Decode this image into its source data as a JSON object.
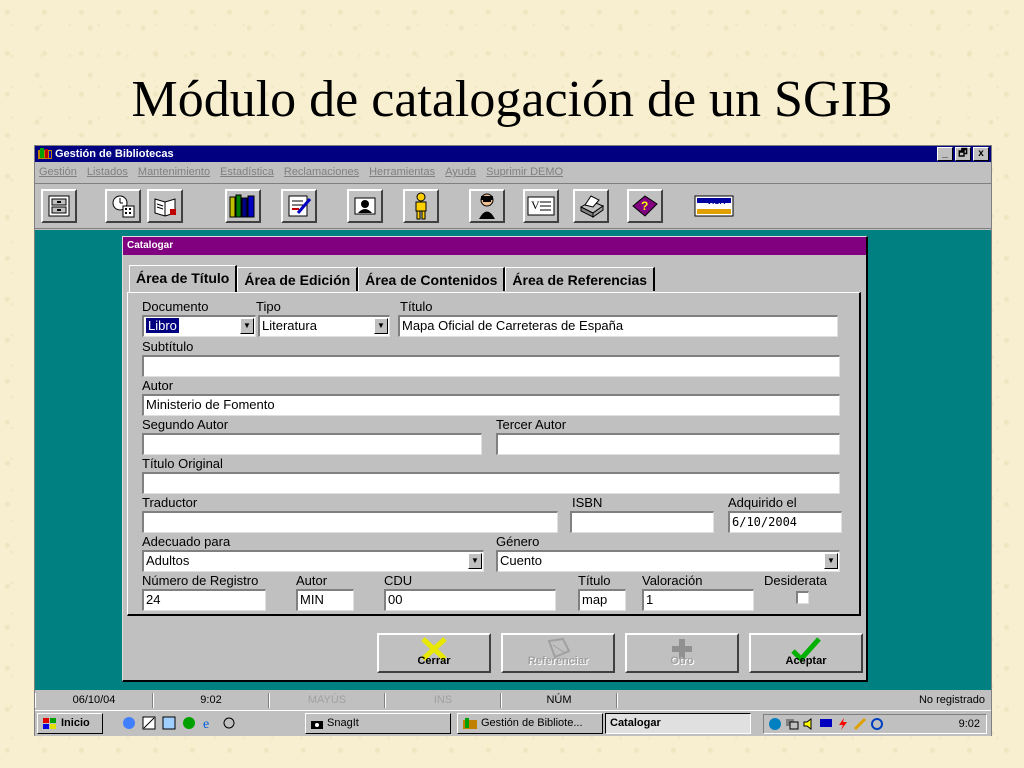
{
  "slide": {
    "title": "Módulo de catalogación de un SGIB"
  },
  "window": {
    "title": "Gestión de Bibliotecas",
    "controls": {
      "minimize": "_",
      "maximize": "🗗",
      "close": "x"
    }
  },
  "menu": [
    "Gestión",
    "Listados",
    "Mantenimiento",
    "Estadística",
    "Reclamaciones",
    "Herramientas",
    "Ayuda",
    "Suprimir DEMO"
  ],
  "toolbar": {
    "icons": [
      "cabinet-icon",
      "calculator-icon",
      "book-reader-icon",
      "books-icon",
      "writing-icon",
      "person-card-icon",
      "person-icon",
      "user-icon",
      "letter-icon",
      "printer-icon",
      "help-book-icon",
      "visa-card-icon"
    ],
    "visa_text": "VISA"
  },
  "dialog": {
    "title": "Catalogar",
    "tabs": [
      "Área de Título",
      "Área de Edición",
      "Área de Contenidos",
      "Área de Referencias"
    ],
    "labels": {
      "documento": "Documento",
      "tipo": "Tipo",
      "titulo": "Título",
      "subtitulo": "Subtítulo",
      "autor": "Autor",
      "segundo_autor": "Segundo Autor",
      "tercer_autor": "Tercer Autor",
      "titulo_original": "Título Original",
      "traductor": "Traductor",
      "isbn": "ISBN",
      "adquirido": "Adquirido el",
      "adecuado": "Adecuado para",
      "genero": "Género",
      "num_registro": "Número de Registro",
      "autor_corto": "Autor",
      "cdu": "CDU",
      "titulo_corto": "Título",
      "valoracion": "Valoración",
      "desiderata": "Desiderata"
    },
    "values": {
      "documento": "Libro",
      "tipo": "Literatura",
      "titulo": "Mapa Oficial de Carreteras de España",
      "subtitulo": "",
      "autor": "Ministerio de Fomento",
      "segundo_autor": "",
      "tercer_autor": "",
      "titulo_original": "",
      "traductor": "",
      "isbn": "",
      "adquirido": "6/10/2004",
      "adecuado": "Adultos",
      "genero": "Cuento",
      "num_registro": "24",
      "autor_corto": "MIN",
      "cdu": "00",
      "titulo_corto": "map",
      "valoracion": "1"
    },
    "buttons": {
      "cerrar": "Cerrar",
      "referenciar": "Referenciar",
      "otro": "Otro",
      "aceptar": "Aceptar"
    }
  },
  "statusbar": {
    "date": "06/10/04",
    "time": "9:02",
    "mayus": "MAYÚS",
    "ins": "INS",
    "num": "NÚM",
    "registro": "No registrado"
  },
  "taskbar": {
    "start": "Inicio",
    "tasks": [
      "SnagIt",
      "Gestión de Bibliote...",
      "Catalogar"
    ],
    "clock": "9:02"
  }
}
